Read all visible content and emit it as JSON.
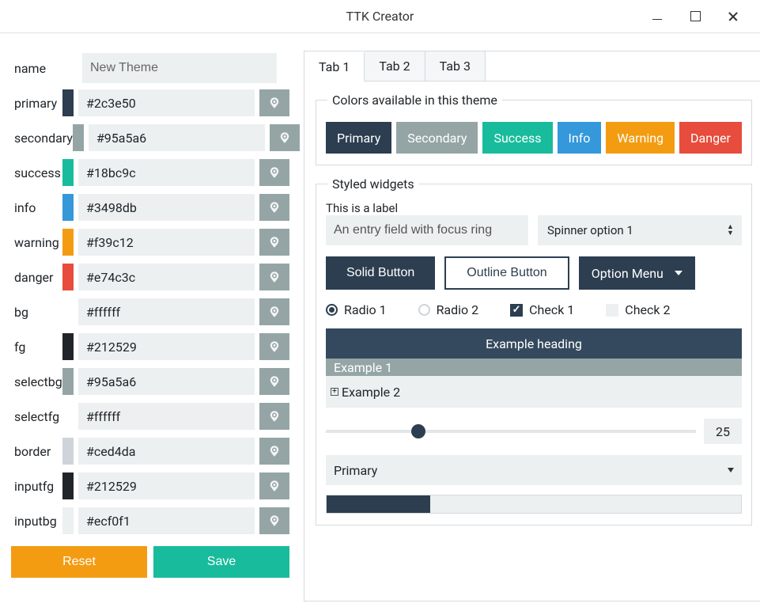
{
  "window": {
    "title": "TTK Creator"
  },
  "form": {
    "name_label": "name",
    "name_value": "New Theme",
    "rows": [
      {
        "label": "primary",
        "value": "#2c3e50",
        "swatch": "#2c3e50"
      },
      {
        "label": "secondary",
        "value": "#95a5a6",
        "swatch": "#95a5a6"
      },
      {
        "label": "success",
        "value": "#18bc9c",
        "swatch": "#18bc9c"
      },
      {
        "label": "info",
        "value": "#3498db",
        "swatch": "#3498db"
      },
      {
        "label": "warning",
        "value": "#f39c12",
        "swatch": "#f39c12"
      },
      {
        "label": "danger",
        "value": "#e74c3c",
        "swatch": "#e74c3c"
      },
      {
        "label": "bg",
        "value": "#ffffff",
        "swatch": "#ffffff"
      },
      {
        "label": "fg",
        "value": "#212529",
        "swatch": "#212529"
      },
      {
        "label": "selectbg",
        "value": "#95a5a6",
        "swatch": "#95a5a6"
      },
      {
        "label": "selectfg",
        "value": "#ffffff",
        "swatch": "#ffffff"
      },
      {
        "label": "border",
        "value": "#ced4da",
        "swatch": "#ced4da"
      },
      {
        "label": "inputfg",
        "value": "#212529",
        "swatch": "#212529"
      },
      {
        "label": "inputbg",
        "value": "#ecf0f1",
        "swatch": "#ecf0f1"
      }
    ],
    "reset_label": "Reset",
    "save_label": "Save"
  },
  "tabs": [
    {
      "label": "Tab 1",
      "active": true
    },
    {
      "label": "Tab 2",
      "active": false
    },
    {
      "label": "Tab 3",
      "active": false
    }
  ],
  "colors_section": {
    "legend": "Colors available in this theme",
    "buttons": [
      {
        "label": "Primary",
        "class": "c-primary"
      },
      {
        "label": "Secondary",
        "class": "c-secondary"
      },
      {
        "label": "Success",
        "class": "c-success"
      },
      {
        "label": "Info",
        "class": "c-info"
      },
      {
        "label": "Warning",
        "class": "c-warning"
      },
      {
        "label": "Danger",
        "class": "c-danger"
      }
    ]
  },
  "styled_section": {
    "legend": "Styled widgets",
    "label_text": "This is a label",
    "entry_value": "An entry field with focus ring",
    "spinner_value": "Spinner option 1",
    "solid_label": "Solid Button",
    "outline_label": "Outline Button",
    "option_label": "Option Menu",
    "radio1": "Radio 1",
    "radio2": "Radio 2",
    "check1": "Check 1",
    "check2": "Check 2",
    "tree_heading": "Example heading",
    "tree_row1": "Example 1",
    "tree_row2": "Example 2",
    "slider_value": "25",
    "slider_percent": 25,
    "select_value": "Primary",
    "progress_percent": 25
  }
}
